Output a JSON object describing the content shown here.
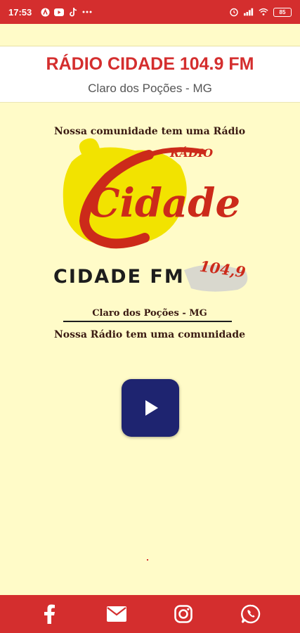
{
  "status_bar": {
    "time": "17:53",
    "battery": "85",
    "icons": [
      "a-icon",
      "youtube-icon",
      "tiktok-icon",
      "more-dots-icon",
      "alarm-icon",
      "signal-icon",
      "wifi-icon",
      "battery-icon"
    ]
  },
  "header": {
    "title": "RÁDIO CIDADE 104.9 FM",
    "subtitle": "Claro dos Poções - MG"
  },
  "logo": {
    "top_slogan": "Nossa comunidade tem uma Rádio",
    "radio_small": "RÁDIO",
    "cidade_word": "Cidade",
    "fm_word": "CIDADE FM",
    "frequency": "104,9",
    "city": "Claro dos Poções - MG",
    "bottom_slogan": "Nossa Rádio tem uma comunidade"
  },
  "player": {
    "button_icon": "play-icon"
  },
  "social": {
    "items": [
      "facebook-icon",
      "email-icon",
      "instagram-icon",
      "whatsapp-icon"
    ]
  },
  "colors": {
    "brand_red": "#d42e2e",
    "background": "#fffbc8",
    "play_button": "#1e2470"
  }
}
